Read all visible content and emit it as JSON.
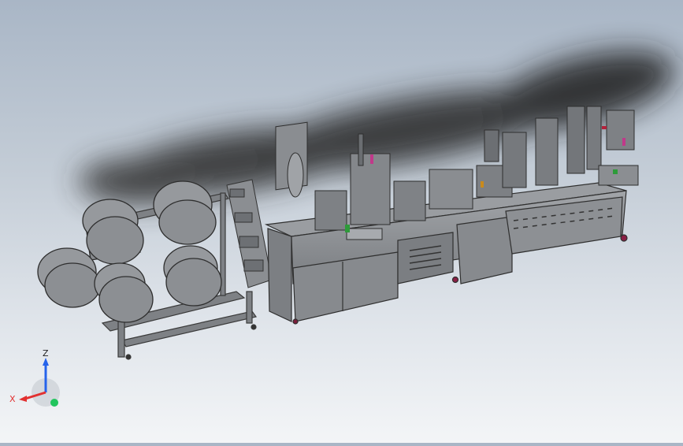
{
  "viewport": {
    "background_top": "#a9b6c6",
    "background_bottom": "#f3f5f7",
    "model_color": "#8f9295",
    "shadow_color": "#2b2b2b"
  },
  "triad": {
    "x_label": "X",
    "y_label": "",
    "z_label": "Z",
    "x_color": "#e23030",
    "y_color": "#22c55e",
    "z_color": "#2563eb"
  }
}
